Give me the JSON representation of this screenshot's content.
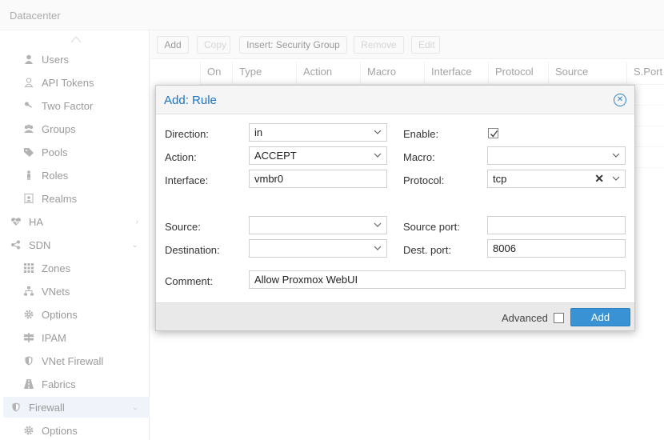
{
  "topbar": {
    "title": "Datacenter"
  },
  "sidebar": {
    "items": [
      {
        "label": "Users",
        "icon": "user-icon"
      },
      {
        "label": "API Tokens",
        "icon": "user-outline-icon"
      },
      {
        "label": "Two Factor",
        "icon": "key-icon"
      },
      {
        "label": "Groups",
        "icon": "users-icon"
      },
      {
        "label": "Pools",
        "icon": "tags-icon"
      },
      {
        "label": "Roles",
        "icon": "male-icon"
      },
      {
        "label": "Realms",
        "icon": "address-book-icon"
      },
      {
        "label": "HA",
        "icon": "heartbeat-icon"
      },
      {
        "label": "SDN",
        "icon": "network-icon"
      },
      {
        "label": "Zones",
        "icon": "grid-icon"
      },
      {
        "label": "VNets",
        "icon": "sitemap-icon"
      },
      {
        "label": "Options",
        "icon": "gear-icon"
      },
      {
        "label": "IPAM",
        "icon": "signs-icon"
      },
      {
        "label": "VNet Firewall",
        "icon": "shield-icon"
      },
      {
        "label": "Fabrics",
        "icon": "road-icon"
      },
      {
        "label": "Firewall",
        "icon": "shield-icon"
      },
      {
        "label": "Options",
        "icon": "gear-icon"
      }
    ]
  },
  "toolbar": {
    "add": "Add",
    "copy": "Copy",
    "insert_sg": "Insert: Security Group",
    "remove": "Remove",
    "edit": "Edit"
  },
  "grid": {
    "columns": [
      "On",
      "Type",
      "Action",
      "Macro",
      "Interface",
      "Protocol",
      "Source",
      "S.Port"
    ]
  },
  "dialog": {
    "title": "Add: Rule",
    "direction_label": "Direction:",
    "direction_value": "in",
    "enable_label": "Enable:",
    "action_label": "Action:",
    "action_value": "ACCEPT",
    "macro_label": "Macro:",
    "macro_value": "",
    "interface_label": "Interface:",
    "interface_value": "vmbr0",
    "protocol_label": "Protocol:",
    "protocol_value": "tcp",
    "source_label": "Source:",
    "source_value": "",
    "source_port_label": "Source port:",
    "source_port_value": "",
    "destination_label": "Destination:",
    "destination_value": "",
    "dest_port_label": "Dest. port:",
    "dest_port_value": "8006",
    "comment_label": "Comment:",
    "comment_value": "Allow Proxmox WebUI",
    "advanced_label": "Advanced",
    "add_button": "Add"
  },
  "colors": {
    "accent": "#3892d4",
    "title_blue": "#1a73c4"
  }
}
